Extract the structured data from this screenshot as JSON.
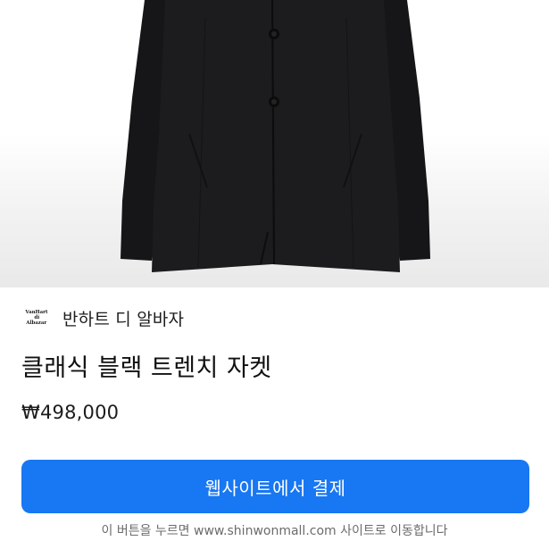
{
  "product": {
    "brand_logo_lines": [
      "VanHart",
      "di",
      "Albazar"
    ],
    "brand_name": "반하트 디 알바자",
    "title": "클래식 블랙 트렌치 자켓",
    "price": "₩498,000"
  },
  "checkout": {
    "button_label": "웹사이트에서 결제",
    "notice": "이 버튼을 누르면 www.shinwonmall.com 사이트로 이동합니다"
  },
  "colors": {
    "accent": "#1877f2",
    "coat": "#1b1b1d"
  }
}
